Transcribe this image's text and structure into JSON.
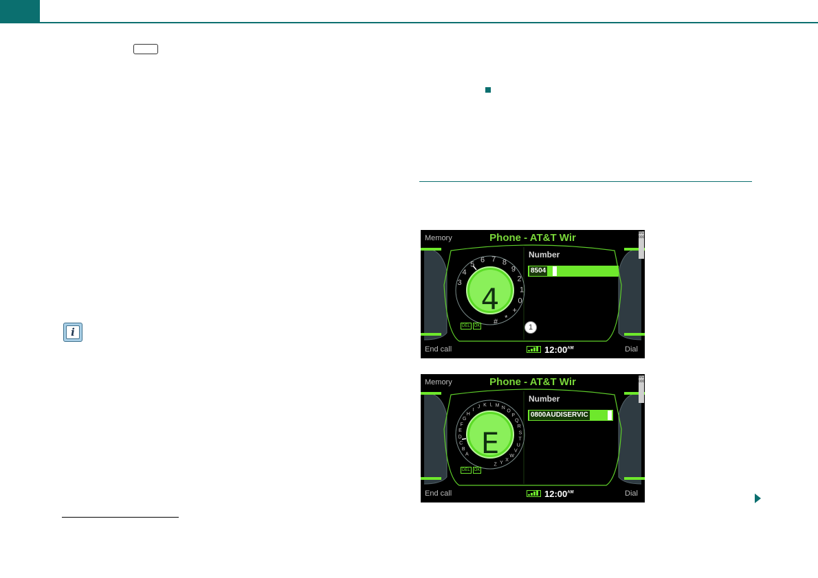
{
  "phone_screen_1": {
    "soft_key_top_left": "Memory",
    "title": "Phone - AT&T Wir",
    "field_label": "Number",
    "field_value": "8504",
    "dial_selected": "4",
    "dial_characters": [
      "3",
      "4",
      "5",
      "6",
      "7",
      "8",
      "9",
      "2",
      "1",
      "0",
      "+",
      "*",
      "#"
    ],
    "speller_buttons": [
      "DEL",
      "OK"
    ],
    "callout_number": "1",
    "soft_key_bottom_left": "End call",
    "soft_key_bottom_right": "Dial",
    "time": "12:00",
    "time_suffix": "AM",
    "side_code": "BN-0000"
  },
  "phone_screen_2": {
    "soft_key_top_left": "Memory",
    "title": "Phone - AT&T Wir",
    "field_label": "Number",
    "field_value": "0800AUDISERVIC",
    "dial_selected": "E",
    "dial_characters": [
      "A",
      "B",
      "C",
      "D",
      "E",
      "F",
      "G",
      "H",
      "I",
      "J",
      "K",
      "L",
      "M",
      "N",
      "O",
      "P",
      "Q",
      "R",
      "S",
      "T",
      "U",
      "V",
      "W",
      "X",
      "Y",
      "Z"
    ],
    "speller_buttons": [
      "DEL",
      "OK"
    ],
    "soft_key_bottom_left": "End call",
    "soft_key_bottom_right": "Dial",
    "time": "12:00",
    "time_suffix": "AM",
    "side_code": "BN-0000"
  },
  "colors": {
    "accent": "#0b6f6f",
    "display_green": "#6ee82c",
    "info_icon": "#a9cfe6"
  },
  "icons": {
    "info": "info-icon",
    "continue": "next-page-arrow-icon",
    "signal": "signal-strength-icon"
  }
}
